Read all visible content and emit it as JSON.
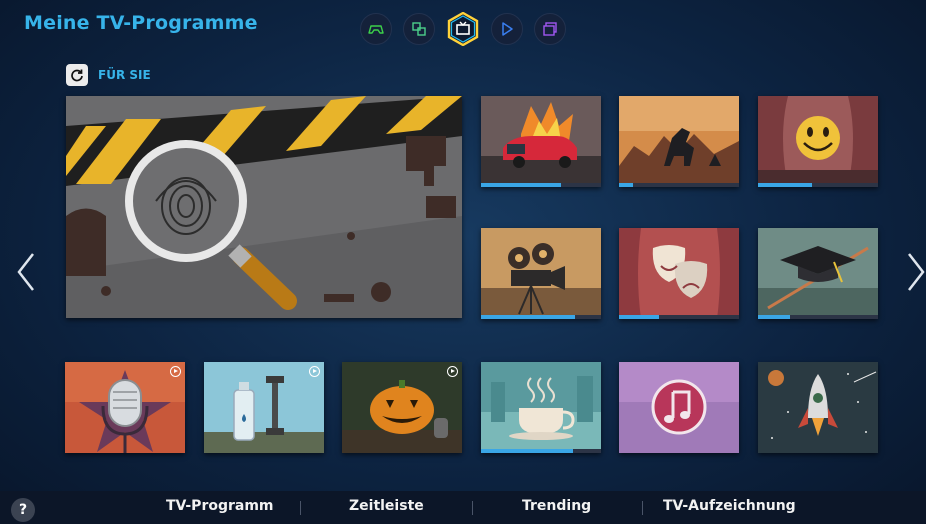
{
  "header": {
    "title": "Meine TV-Programme"
  },
  "top_nav": {
    "items": [
      {
        "icon": "gamepad-icon",
        "active": false
      },
      {
        "icon": "multiscreen-icon",
        "active": false
      },
      {
        "icon": "tv-icon",
        "active": true
      },
      {
        "icon": "play-icon",
        "active": false
      },
      {
        "icon": "apps-icon",
        "active": false
      }
    ]
  },
  "section": {
    "label": "FÜR SIE",
    "icon": "refresh-icon"
  },
  "featured": {
    "art": "magnifier-fingerprint",
    "progress": null
  },
  "tiles": [
    {
      "art": "burning-car",
      "progress": 0.67,
      "play": false
    },
    {
      "art": "dark-horse-rider",
      "progress": 0.12,
      "play": false
    },
    {
      "art": "smiley-stage",
      "progress": 0.45,
      "play": false
    },
    {
      "art": "film-camera",
      "progress": 0.78,
      "play": false
    },
    {
      "art": "theater-masks",
      "progress": 0.33,
      "play": false
    },
    {
      "art": "graduation-cap",
      "progress": 0.27,
      "play": false
    },
    {
      "art": "microphone-star",
      "progress": null,
      "play": true
    },
    {
      "art": "water-bottle-dumbbell",
      "progress": null,
      "play": true
    },
    {
      "art": "halloween-pumpkin",
      "progress": null,
      "play": true
    },
    {
      "art": "coffee-cup",
      "progress": 0.77,
      "play": false
    },
    {
      "art": "music-note",
      "progress": null,
      "play": false
    },
    {
      "art": "space-rocket",
      "progress": null,
      "play": false
    }
  ],
  "colors": {
    "accent": "#37b4ea",
    "background": "#0d2442",
    "progress": "#3aa6e6"
  },
  "bottom_tabs": [
    "TV-Programm",
    "Zeitleiste",
    "Trending",
    "TV-Aufzeichnung"
  ],
  "help": {
    "label": "?"
  }
}
